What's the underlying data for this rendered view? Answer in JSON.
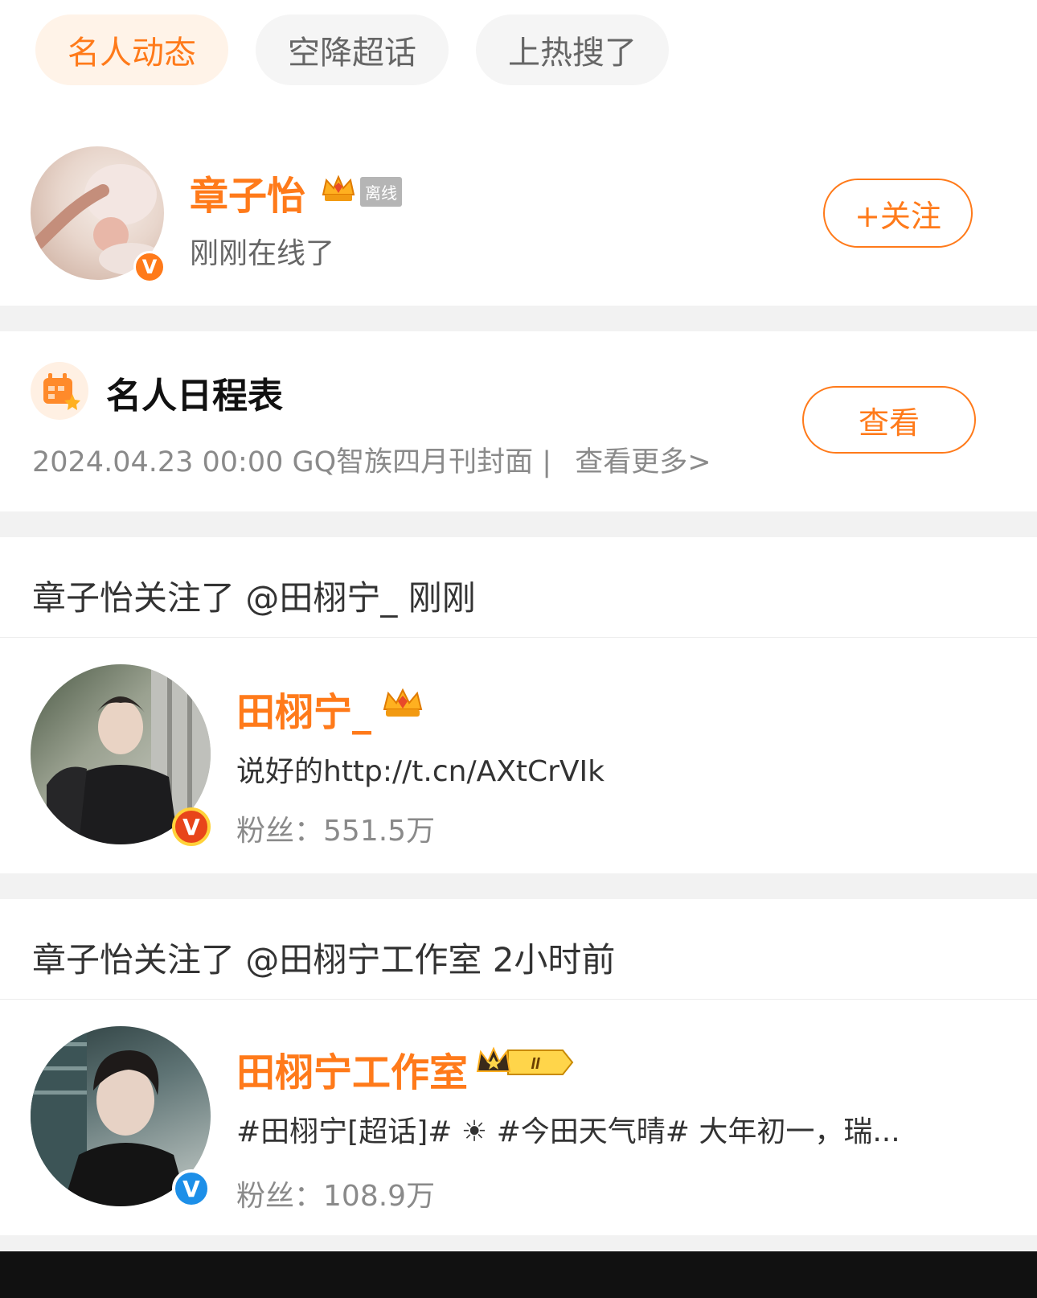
{
  "tabs": [
    {
      "label": "名人动态",
      "active": true
    },
    {
      "label": "空降超话",
      "active": false
    },
    {
      "label": "上热搜了",
      "active": false
    }
  ],
  "celebrity": {
    "name": "章子怡",
    "status_tag": "离线",
    "status_text": "刚刚在线了",
    "follow_label": "+关注",
    "verified_badge": "V"
  },
  "schedule": {
    "title": "名人日程表",
    "detail": "2024.04.23 00:00 GQ智族四月刊封面 |",
    "more": "查看更多>",
    "view_label": "查看"
  },
  "activities": [
    {
      "title": "章子怡关注了 @田栩宁_ 刚刚",
      "name": "田栩宁_",
      "desc": "说好的http://t.cn/AXtCrVIk",
      "fans_label": "粉丝：",
      "fans_value": "551.5万",
      "badge_color": "#e8451a"
    },
    {
      "title": "章子怡关注了 @田栩宁工作室 2小时前",
      "name": "田栩宁工作室",
      "desc": "#田栩宁[超话]# ☀ #今田天气晴# 大年初一，瑞...",
      "fans_label": "粉丝：",
      "fans_value": "108.9万",
      "badge_color": "#1d8fe8"
    }
  ],
  "colors": {
    "accent": "#ff7a1a",
    "divider": "#f2f2f2"
  }
}
